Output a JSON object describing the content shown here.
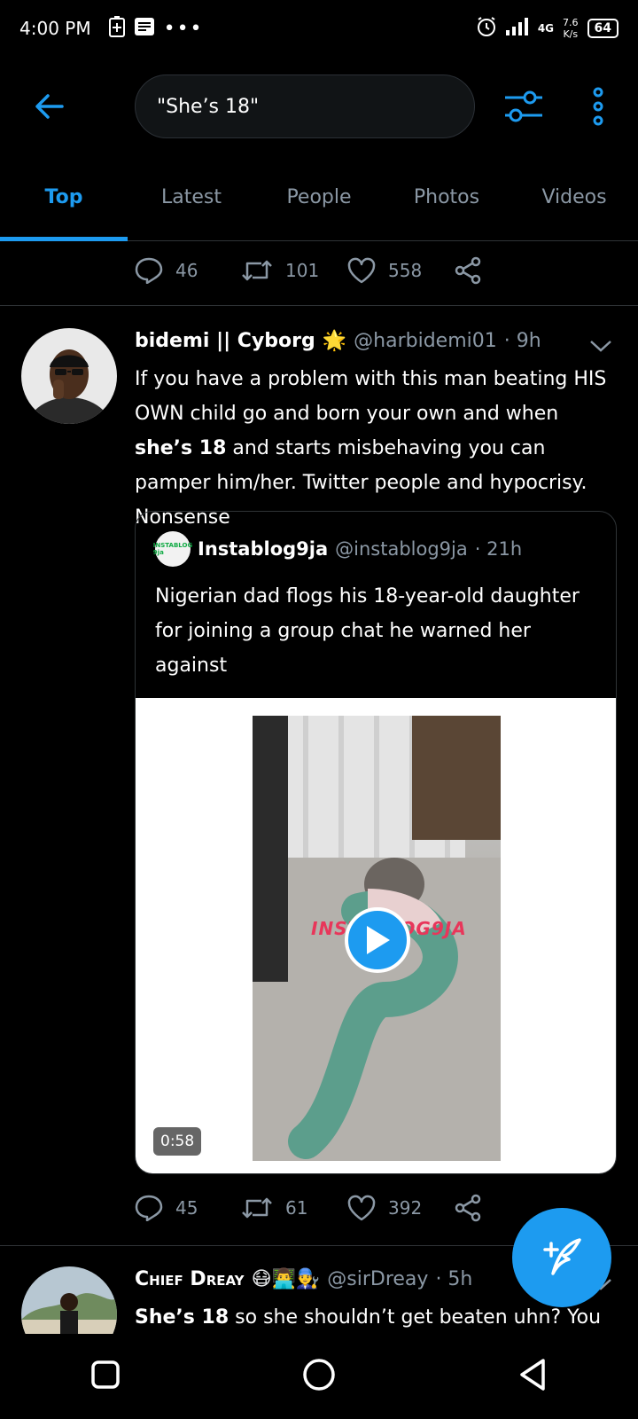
{
  "status_bar": {
    "time": "4:00 PM",
    "network": "4G",
    "speed": "7.6",
    "speed_unit": "K/s",
    "battery": "64"
  },
  "header": {
    "search_value": "\"She’s 18\""
  },
  "tabs": [
    {
      "label": "Top",
      "active": true
    },
    {
      "label": "Latest",
      "active": false
    },
    {
      "label": "People",
      "active": false
    },
    {
      "label": "Photos",
      "active": false
    },
    {
      "label": "Videos",
      "active": false
    }
  ],
  "prev_tweet_actions": {
    "replies": "46",
    "retweets": "101",
    "likes": "558"
  },
  "tweet1": {
    "name": "bidemi || Cyborg",
    "emoji": "🌟",
    "handle": "@harbidemi01",
    "time": "· 9h",
    "text_part1": "If you have a problem with this man beating HIS OWN child go and born your own and when",
    "text_bold": "she’s 18",
    "text_part2": "and starts misbehaving you can pamper him/her. Twitter people and hypocrisy. Nonsense",
    "quote": {
      "avatar_text": "INSTABLOG 9ja",
      "name": "Instablog9ja",
      "handle": "@instablog9ja",
      "time": "· 21h",
      "text": "Nigerian dad flogs his 18-year-old daughter for joining a group chat he warned her against",
      "watermark": "INSTABLOG9JA",
      "duration": "0:58"
    },
    "replies": "45",
    "retweets": "61",
    "likes": "392"
  },
  "tweet2": {
    "name": "Chief Dreay",
    "emoji": "😷👨‍💻👨‍🔧",
    "handle": "@sirDreay",
    "time": "· 5h",
    "text_bold": "She’s 18",
    "text_part2": "so she shouldn’t get beaten uhn? You"
  },
  "colors": {
    "accent": "#1d9bf0",
    "background": "#000000",
    "secondary_text": "#8b98a5"
  }
}
